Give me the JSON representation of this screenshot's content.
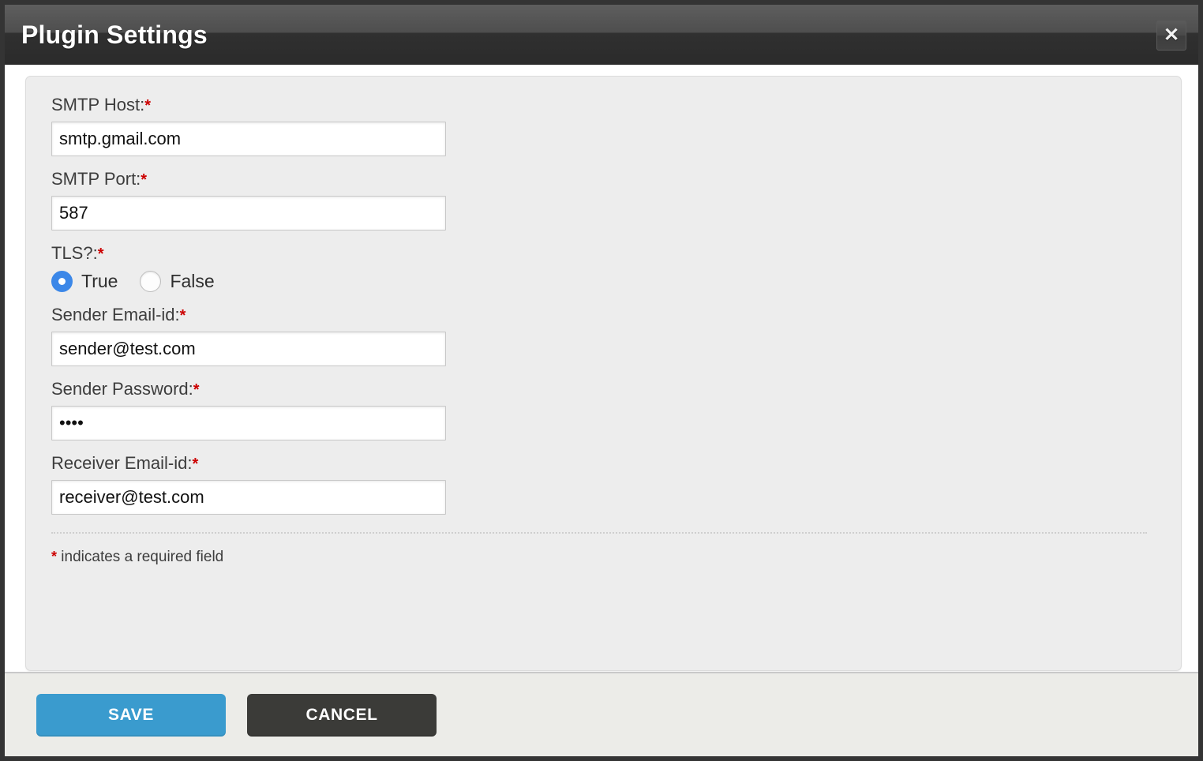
{
  "dialog": {
    "title": "Plugin Settings",
    "close_icon": "close-icon",
    "close_label": "✕"
  },
  "form": {
    "fields": [
      {
        "label": "SMTP Host:",
        "required_marker": "*",
        "value": "smtp.gmail.com",
        "placeholder": ""
      },
      {
        "label": "SMTP Port:",
        "required_marker": "*",
        "value": "587",
        "placeholder": ""
      },
      {
        "label": "Sender Email-id:",
        "required_marker": "*",
        "value": "sender@test.com",
        "placeholder": ""
      },
      {
        "label": "Sender Password:",
        "required_marker": "*",
        "value": "••••",
        "placeholder": ""
      },
      {
        "label": "Receiver Email-id:",
        "required_marker": "*",
        "value": "receiver@test.com",
        "placeholder": ""
      }
    ],
    "tls": {
      "label": "TLS?:",
      "required_marker": "*",
      "options": [
        {
          "label": "True",
          "selected": true
        },
        {
          "label": "False",
          "selected": false
        }
      ]
    },
    "required_note_star": "*",
    "required_note_text": "indicates a required field"
  },
  "footer": {
    "save_label": "SAVE",
    "cancel_label": "CANCEL"
  },
  "colors": {
    "accent_blue": "#3a9bce",
    "radio_blue": "#3b87e8",
    "required_red": "#cc0000",
    "titlebar_dark": "#2b2b2b",
    "panel_bg": "#ededed",
    "footer_bg": "#ecece8"
  }
}
